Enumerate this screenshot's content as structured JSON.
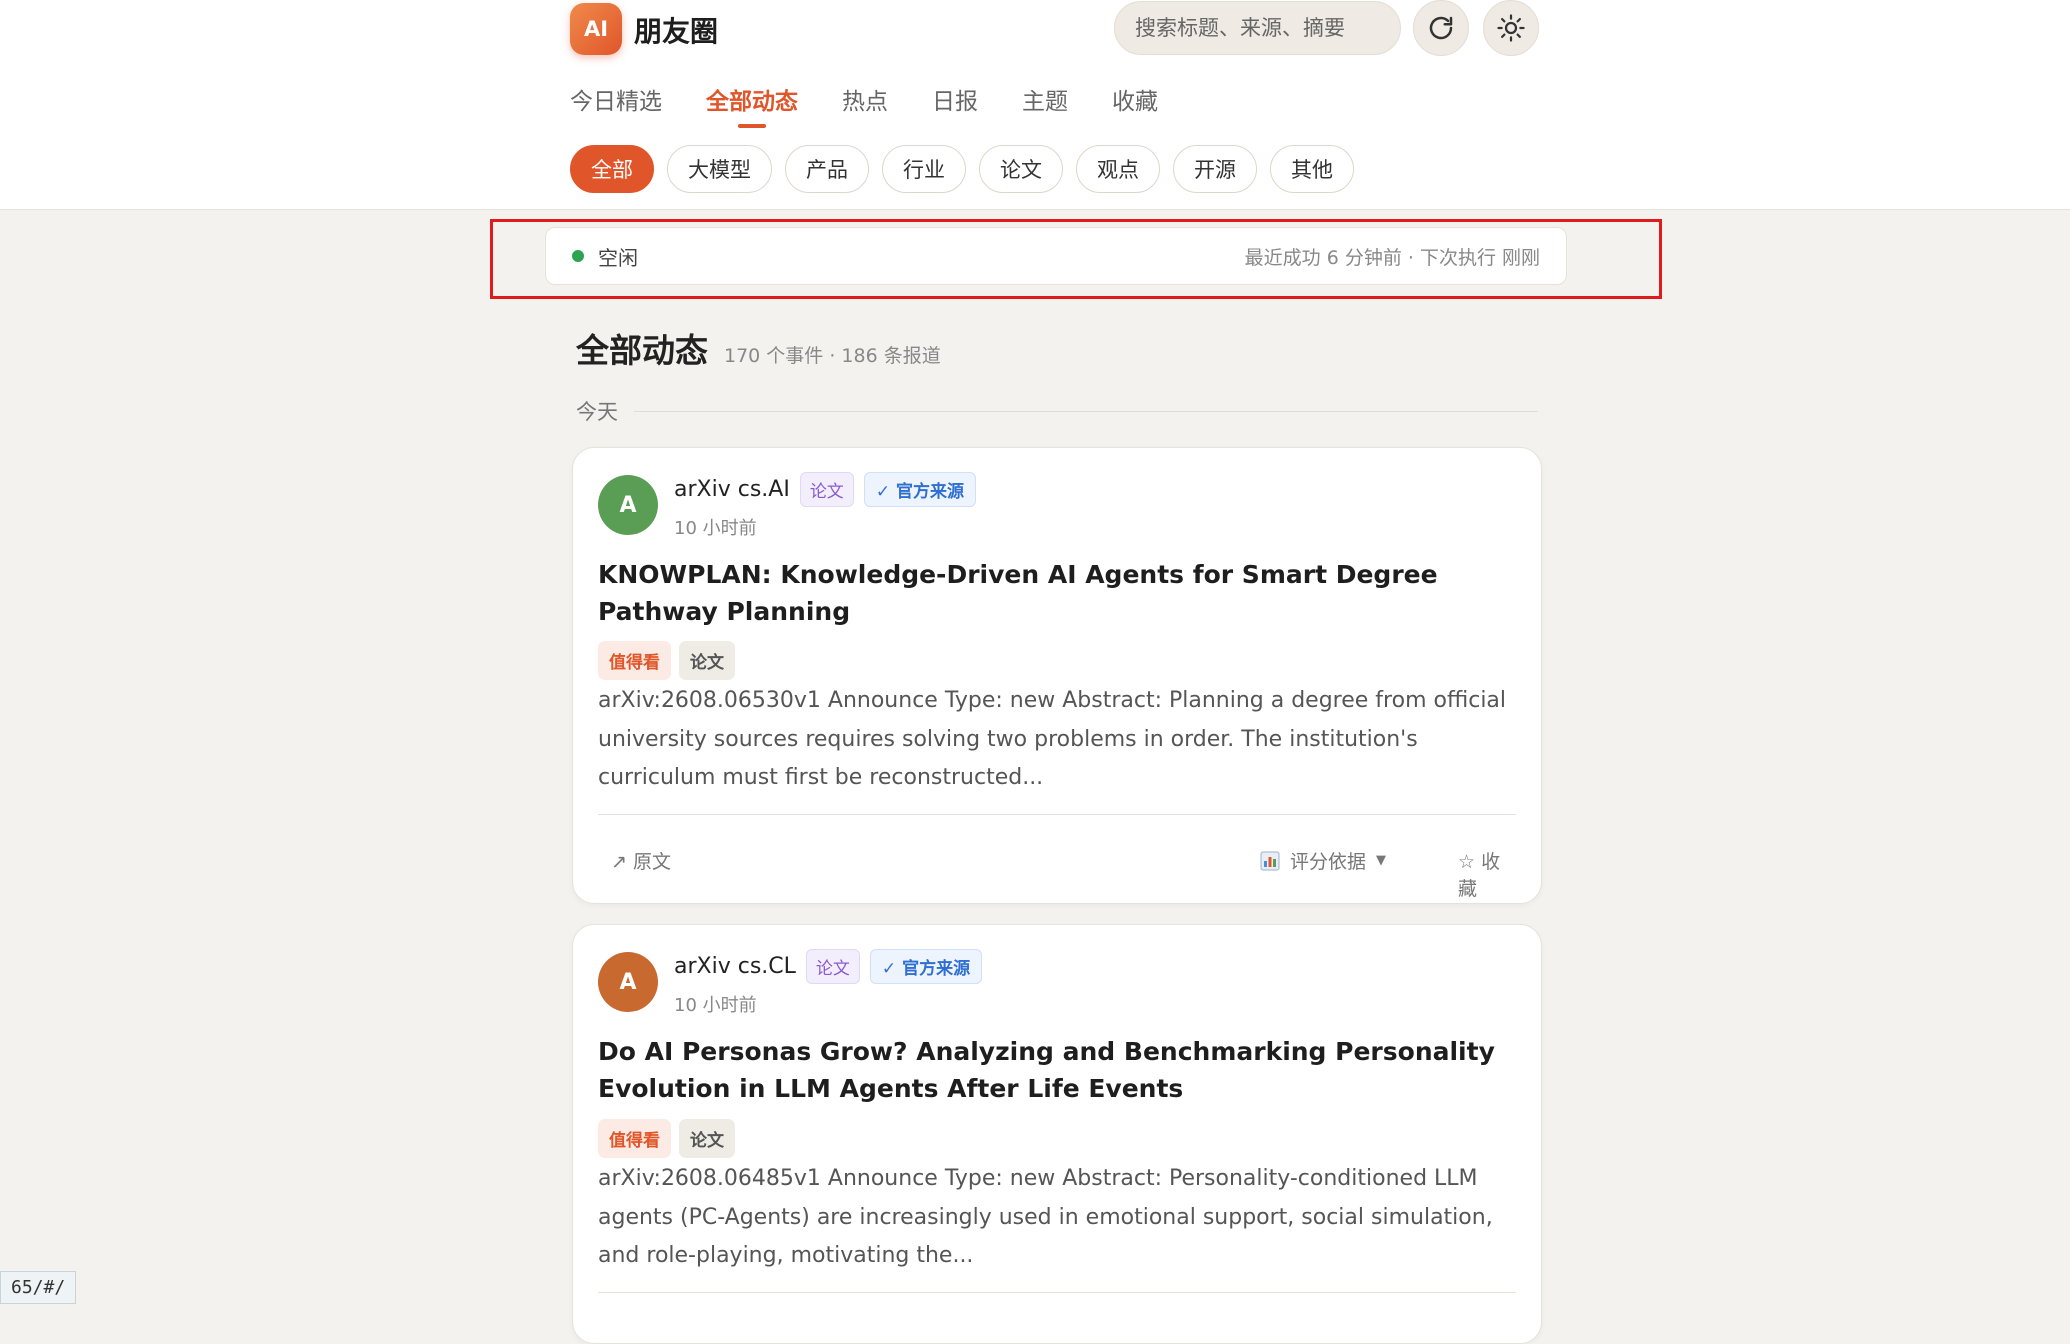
{
  "app": {
    "logo_text": "AI",
    "title": "朋友圈"
  },
  "search": {
    "placeholder": "搜索标题、来源、摘要"
  },
  "nav_tabs": [
    {
      "label": "今日精选"
    },
    {
      "label": "全部动态",
      "active": true
    },
    {
      "label": "热点"
    },
    {
      "label": "日报"
    },
    {
      "label": "主题"
    },
    {
      "label": "收藏"
    }
  ],
  "filter_chips": [
    {
      "label": "全部",
      "active": true
    },
    {
      "label": "大模型"
    },
    {
      "label": "产品"
    },
    {
      "label": "行业"
    },
    {
      "label": "论文"
    },
    {
      "label": "观点"
    },
    {
      "label": "开源"
    },
    {
      "label": "其他"
    }
  ],
  "status": {
    "state": "空闲",
    "detail": "最近成功 6 分钟前 · 下次执行 刚刚",
    "dot_color": "#2ea44f"
  },
  "feed": {
    "title": "全部动态",
    "subtitle": "170 个事件 · 186 条报道",
    "day_label": "今天"
  },
  "cards": [
    {
      "avatar_letter": "A",
      "avatar_color": "#5a9e56",
      "source": "arXiv cs.AI",
      "category_tag": "论文",
      "official_tag": "✓ 官方来源",
      "time": "10 小时前",
      "title": "KNOWPLAN: Knowledge-Driven AI Agents for Smart Degree Pathway Planning",
      "badge_hot": "值得看",
      "badge_cat": "论文",
      "abstract": "arXiv:2608.06530v1 Announce Type: new Abstract: Planning a degree from official university sources requires solving two problems in order. The institution's curriculum must first be reconstructed...",
      "action_source": "↗ 原文",
      "action_score": "评分依据",
      "action_fav": "☆ 收藏"
    },
    {
      "avatar_letter": "A",
      "avatar_color": "#c86a30",
      "source": "arXiv cs.CL",
      "category_tag": "论文",
      "official_tag": "✓ 官方来源",
      "time": "10 小时前",
      "title": "Do AI Personas Grow? Analyzing and Benchmarking Personality Evolution in LLM Agents After Life Events",
      "badge_hot": "值得看",
      "badge_cat": "论文",
      "abstract": "arXiv:2608.06485v1 Announce Type: new Abstract: Personality-conditioned LLM agents (PC-Agents) are increasingly used in emotional support, social simulation, and role-playing, motivating the..."
    }
  ],
  "url_fragment": "65/#/"
}
